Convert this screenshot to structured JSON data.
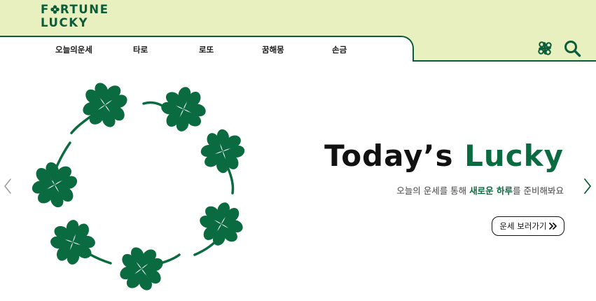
{
  "brand": {
    "logo_line1_pre": "F",
    "logo_line1_post": "RTUNE",
    "logo_line2": "LUCKY",
    "logo_clover_icon": "clover-icon",
    "color": "#0b5c38",
    "header_bg": "#e8f0c0"
  },
  "nav": {
    "items": [
      {
        "label": "오늘의운세"
      },
      {
        "label": "타로"
      },
      {
        "label": "로또"
      },
      {
        "label": "꿈해몽"
      },
      {
        "label": "손금"
      }
    ]
  },
  "header_actions": {
    "clover_icon": "clover-icon",
    "search_icon": "search-icon"
  },
  "hero": {
    "title_plain": "Today’s",
    "title_accent": "Lucky",
    "subtitle_pre": "오늘의 운세를 통해",
    "subtitle_accent": "새로운 하루",
    "subtitle_post": "를 준비해봐요",
    "cta_label": "운세 보러가기",
    "cta_icon": "double-chevron-right-icon",
    "accent_color": "#0b6b40",
    "illustration": "shamrock-wreath"
  },
  "carousel": {
    "prev_icon": "chevron-left-icon",
    "next_icon": "chevron-right-icon"
  }
}
